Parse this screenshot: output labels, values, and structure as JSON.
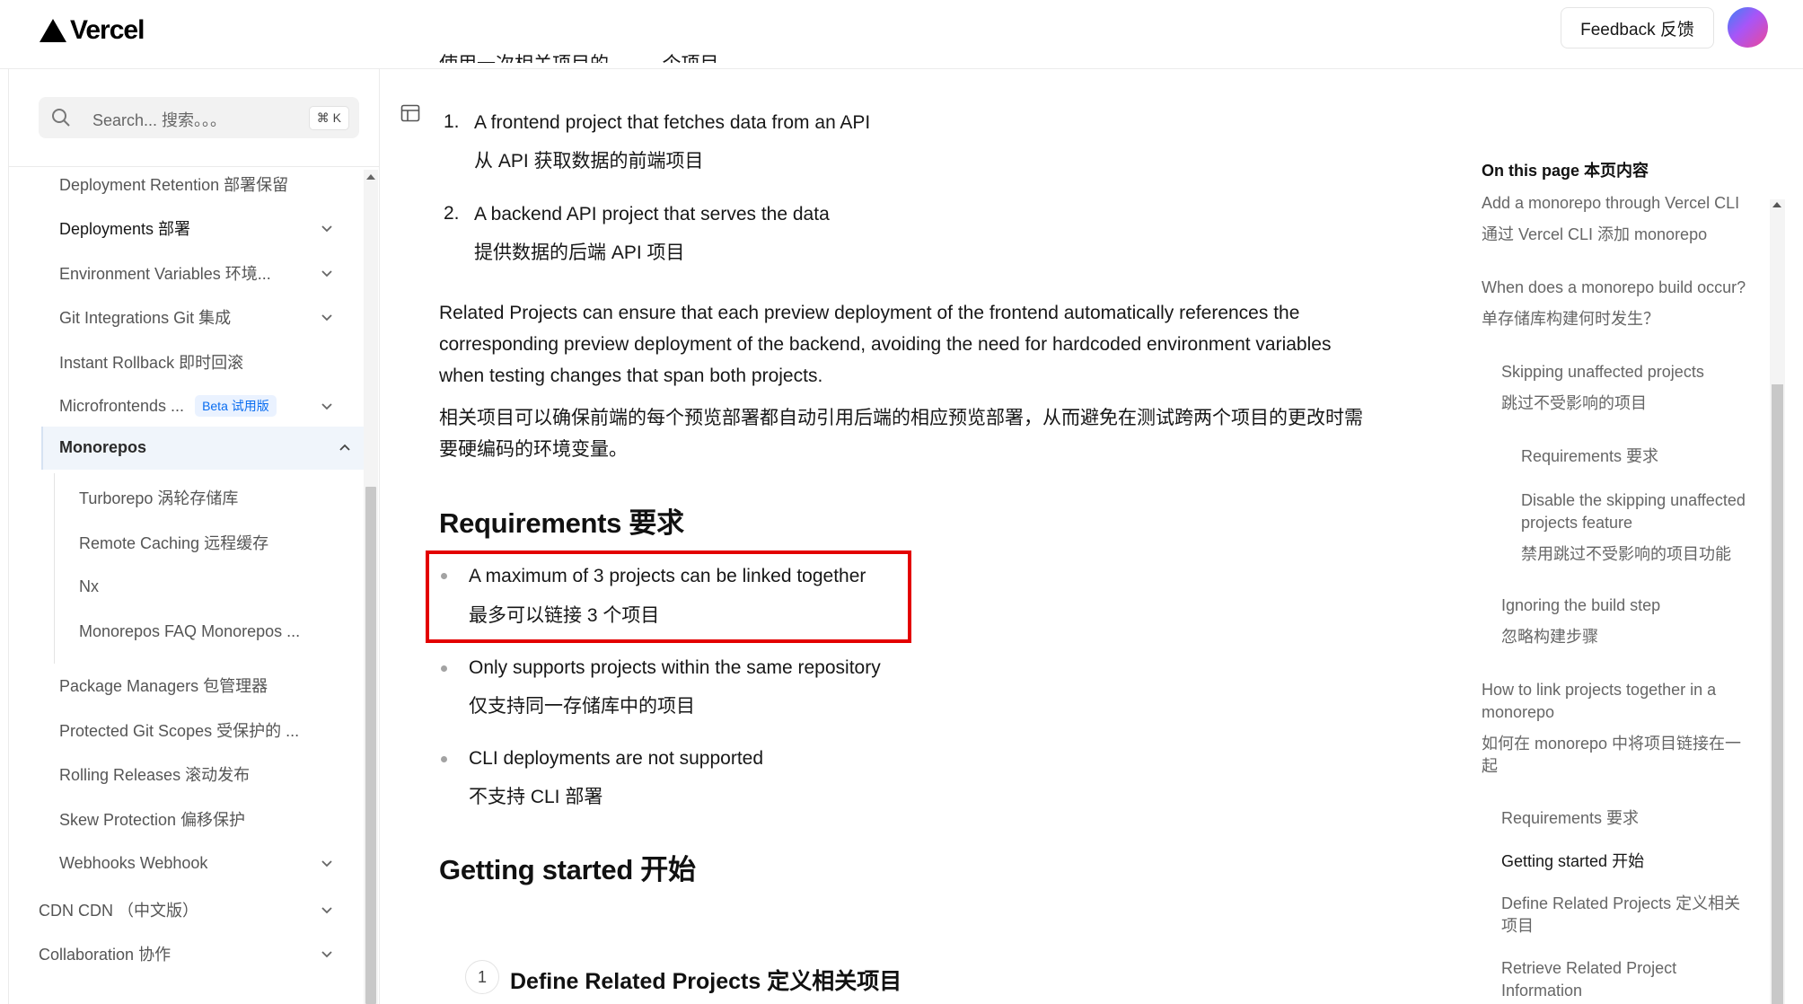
{
  "header": {
    "logo_text": "Vercel",
    "feedback_label": "Feedback 反馈"
  },
  "sidebar": {
    "search": {
      "placeholder": "Search... 搜索。。。",
      "shortcut": "⌘ K"
    },
    "items": [
      {
        "label": "Deployment Retention  部署保留",
        "expandable": false
      },
      {
        "label": "Deployments  部署",
        "expandable": true
      },
      {
        "label": "Environment Variables  环境...",
        "expandable": true
      },
      {
        "label": "Git Integrations  Git 集成",
        "expandable": true
      },
      {
        "label": "Instant Rollback  即时回滚",
        "expandable": false
      },
      {
        "label": "Microfrontends  ...",
        "badge": "Beta  试用版",
        "expandable": true
      },
      {
        "label": "Monorepos",
        "active": true,
        "expanded": true
      },
      {
        "label": "Turborepo  涡轮存储库"
      },
      {
        "label": "Remote Caching  远程缓存"
      },
      {
        "label": "Nx"
      },
      {
        "label": "Monorepos FAQ  Monorepos ..."
      },
      {
        "label": "Package Managers  包管理器"
      },
      {
        "label": "Protected Git Scopes  受保护的 ..."
      },
      {
        "label": "Rolling Releases  滚动发布"
      },
      {
        "label": "Skew Protection  偏移保护"
      },
      {
        "label": "Webhooks  Webhook",
        "expandable": true
      },
      {
        "label": "CDN  CDN （中文版）",
        "expandable": true
      },
      {
        "label": "Collaboration  协作",
        "expandable": true
      }
    ]
  },
  "main": {
    "cut_line": "使用一次相关项目的 ··· ··· 个项目",
    "list": [
      {
        "num": "1.",
        "en": "A frontend project that fetches data from an API",
        "zh": "从 API 获取数据的前端项目"
      },
      {
        "num": "2.",
        "en": "A backend API project that serves the data",
        "zh": "提供数据的后端 API 项目"
      }
    ],
    "para_en": [
      "Related Projects can ensure that each preview deployment of the frontend automatically references the",
      "corresponding preview deployment of the backend, avoiding the need for hardcoded environment variables",
      "when testing changes that span both projects."
    ],
    "para_zh": [
      "相关项目可以确保前端的每个预览部署都自动引用后端的相应预览部署，从而避免在测试跨两个项目的更改时需",
      "要硬编码的环境变量。"
    ],
    "requirements_heading": "Requirements  要求",
    "requirements": [
      {
        "en": "A maximum of 3 projects can be linked together",
        "zh": "最多可以链接 3 个项目",
        "highlighted": true
      },
      {
        "en": "Only supports projects within the same repository",
        "zh": "仅支持同一存储库中的项目"
      },
      {
        "en": "CLI deployments are not supported",
        "zh": "不支持 CLI 部署"
      }
    ],
    "getting_started_heading": "Getting started  开始",
    "step": {
      "num": "1",
      "title": "Define Related Projects  定义相关项目"
    }
  },
  "toc": {
    "heading": "On this page  本页内容",
    "items": [
      {
        "lines": [
          "Add a monorepo through Vercel CLI",
          "通过 Vercel CLI 添加 monorepo"
        ],
        "level": 0
      },
      {
        "lines": [
          "When does a monorepo build occur?",
          "单存储库构建何时发生？"
        ],
        "level": 0
      },
      {
        "lines": [
          "Skipping unaffected projects",
          "跳过不受影响的项目"
        ],
        "level": 1
      },
      {
        "lines": [
          "Requirements  要求"
        ],
        "level": 2
      },
      {
        "lines": [
          "Disable the skipping unaffected",
          "projects feature",
          "禁用跳过不受影响的项目功能"
        ],
        "level": 2
      },
      {
        "lines": [
          "Ignoring the build step",
          "忽略构建步骤"
        ],
        "level": 1
      },
      {
        "lines": [
          "How to link projects together in a",
          "monorepo",
          "如何在 monorepo 中将项目链接在一",
          "起"
        ],
        "level": 0
      },
      {
        "lines": [
          "Requirements  要求"
        ],
        "level": 1
      },
      {
        "lines": [
          "Getting started  开始"
        ],
        "level": 1,
        "current": true
      },
      {
        "lines": [
          "Define Related Projects  定义相关",
          "项目"
        ],
        "level": 1
      },
      {
        "lines": [
          "Retrieve Related Project",
          "Information"
        ],
        "level": 1
      }
    ]
  }
}
